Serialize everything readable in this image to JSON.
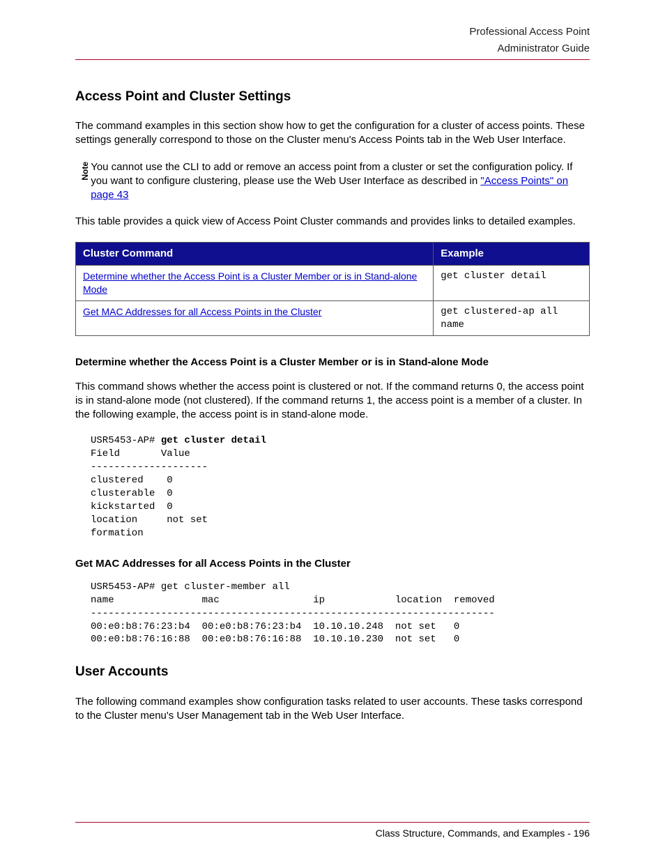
{
  "header": {
    "line1": "Professional Access Point",
    "line2": "Administrator Guide"
  },
  "section1": {
    "title": "Access Point and Cluster Settings",
    "intro": "The command examples in this section show how to get the configuration for a cluster of access points. These settings generally correspond to those on the Cluster menu's Access Points tab in the Web User Interface.",
    "note_label": "Note",
    "note_pre": "You cannot use the CLI to add or remove an access point from a cluster or set the configuration policy. If you want to configure clustering, please use the Web User Interface as described in ",
    "note_link": "\"Access Points\" on page 43",
    "table_intro": "This table provides a quick view of Access Point Cluster commands and provides links to detailed examples.",
    "table": {
      "th1": "Cluster Command",
      "th2": "Example",
      "rows": [
        {
          "cmd": "Determine whether the Access Point is a Cluster Member or is in Stand-alone Mode",
          "ex": "get cluster detail"
        },
        {
          "cmd": "Get MAC Addresses for all Access Points in the Cluster",
          "ex": "get clustered-ap all name"
        }
      ]
    },
    "sub1": {
      "title": "Determine whether the Access Point is a Cluster Member or is in Stand-alone Mode",
      "desc": "This command shows whether the access point is clustered or not. If the command returns 0, the access point is in stand-alone mode (not clustered). If the command returns 1, the access point is a member of a cluster. In the following example, the access point is in stand-alone mode.",
      "prompt": "USR5453-AP# ",
      "cmd": "get cluster detail",
      "out": "Field       Value\n--------------------\nclustered    0\nclusterable  0\nkickstarted  0\nlocation     not set\nformation"
    },
    "sub2": {
      "title": "Get MAC Addresses for all Access Points in the Cluster",
      "block": "USR5453-AP# get cluster-member all\nname               mac                ip            location  removed\n---------------------------------------------------------------------\n00:e0:b8:76:23:b4  00:e0:b8:76:23:b4  10.10.10.248  not set   0\n00:e0:b8:76:16:88  00:e0:b8:76:16:88  10.10.10.230  not set   0"
    }
  },
  "section2": {
    "title": "User Accounts",
    "intro": "The following command examples show configuration tasks related to user accounts. These tasks correspond to the Cluster menu's User Management tab in the Web User Interface."
  },
  "footer": {
    "text": "Class Structure, Commands, and Examples - 196"
  }
}
